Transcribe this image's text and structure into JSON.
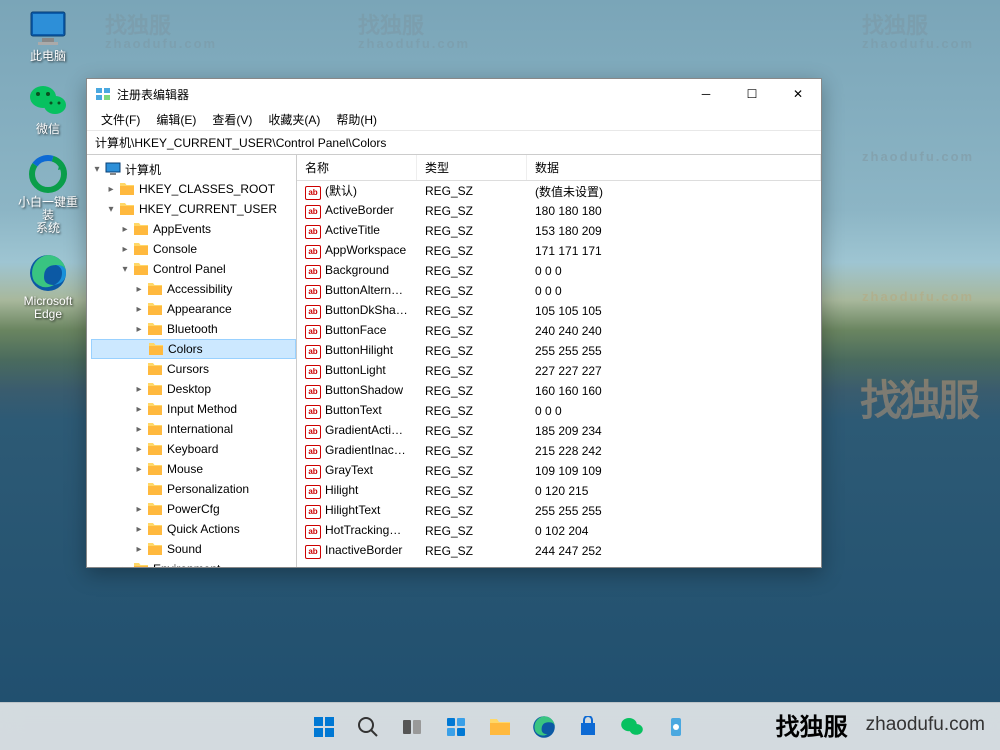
{
  "desktop": {
    "icons": [
      {
        "name": "pc",
        "label": "此电脑"
      },
      {
        "name": "wechat",
        "label": "微信"
      },
      {
        "name": "reinstall",
        "label": "小白一键重装\n系统"
      },
      {
        "name": "edge",
        "label": "Microsoft\nEdge"
      }
    ]
  },
  "window": {
    "title": "注册表编辑器",
    "menu": [
      "文件(F)",
      "编辑(E)",
      "查看(V)",
      "收藏夹(A)",
      "帮助(H)"
    ],
    "address": "计算机\\HKEY_CURRENT_USER\\Control Panel\\Colors",
    "tree": {
      "root": "计算机",
      "hkcr": "HKEY_CLASSES_ROOT",
      "hkcu": "HKEY_CURRENT_USER",
      "hkcu_children": [
        "AppEvents",
        "Console",
        "Control Panel"
      ],
      "cp_children": [
        "Accessibility",
        "Appearance",
        "Bluetooth",
        "Colors",
        "Cursors",
        "Desktop",
        "Input Method",
        "International",
        "Keyboard",
        "Mouse",
        "Personalization",
        "PowerCfg",
        "Quick Actions",
        "Sound"
      ],
      "environment": "Environment",
      "selected": "Colors"
    },
    "columns": {
      "name": "名称",
      "type": "类型",
      "data": "数据"
    },
    "values": [
      {
        "name": "(默认)",
        "type": "REG_SZ",
        "data": "(数值未设置)"
      },
      {
        "name": "ActiveBorder",
        "type": "REG_SZ",
        "data": "180 180 180"
      },
      {
        "name": "ActiveTitle",
        "type": "REG_SZ",
        "data": "153 180 209"
      },
      {
        "name": "AppWorkspace",
        "type": "REG_SZ",
        "data": "171 171 171"
      },
      {
        "name": "Background",
        "type": "REG_SZ",
        "data": "0 0 0"
      },
      {
        "name": "ButtonAlternat...",
        "type": "REG_SZ",
        "data": "0 0 0"
      },
      {
        "name": "ButtonDkShad...",
        "type": "REG_SZ",
        "data": "105 105 105"
      },
      {
        "name": "ButtonFace",
        "type": "REG_SZ",
        "data": "240 240 240"
      },
      {
        "name": "ButtonHilight",
        "type": "REG_SZ",
        "data": "255 255 255"
      },
      {
        "name": "ButtonLight",
        "type": "REG_SZ",
        "data": "227 227 227"
      },
      {
        "name": "ButtonShadow",
        "type": "REG_SZ",
        "data": "160 160 160"
      },
      {
        "name": "ButtonText",
        "type": "REG_SZ",
        "data": "0 0 0"
      },
      {
        "name": "GradientActive...",
        "type": "REG_SZ",
        "data": "185 209 234"
      },
      {
        "name": "GradientInactiv...",
        "type": "REG_SZ",
        "data": "215 228 242"
      },
      {
        "name": "GrayText",
        "type": "REG_SZ",
        "data": "109 109 109"
      },
      {
        "name": "Hilight",
        "type": "REG_SZ",
        "data": "0 120 215"
      },
      {
        "name": "HilightText",
        "type": "REG_SZ",
        "data": "255 255 255"
      },
      {
        "name": "HotTrackingCo...",
        "type": "REG_SZ",
        "data": "0 102 204"
      },
      {
        "name": "InactiveBorder",
        "type": "REG_SZ",
        "data": "244 247 252"
      }
    ]
  },
  "watermark": {
    "main": "找独服",
    "sub": "zhaodufu.com"
  },
  "branding": {
    "cn": "找独服",
    "url": "zhaodufu.com"
  }
}
